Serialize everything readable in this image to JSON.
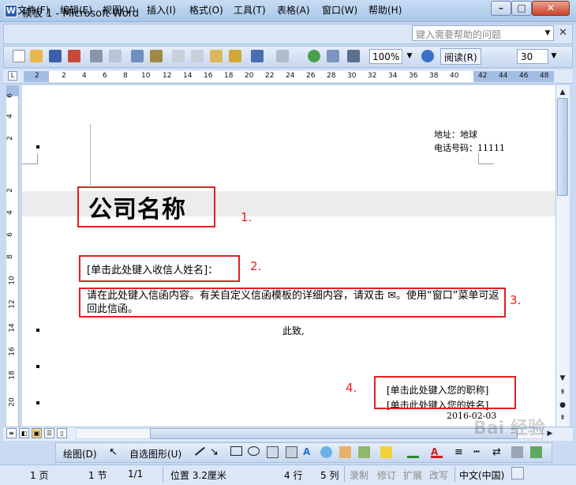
{
  "window": {
    "title": "模板 1 - Microsoft Word"
  },
  "menu": {
    "items": [
      "文件(F)",
      "编辑(E)",
      "视图(V)",
      "插入(I)",
      "格式(O)",
      "工具(T)",
      "表格(A)",
      "窗口(W)",
      "帮助(H)"
    ],
    "help_placeholder": "键入需要帮助的问题"
  },
  "toolbar": {
    "zoom": "100%",
    "read_label": "阅读(R)",
    "font_size": "30"
  },
  "ruler": {
    "h_numbers": [
      "2",
      "2",
      "4",
      "6",
      "8",
      "10",
      "12",
      "14",
      "16",
      "18",
      "20",
      "22",
      "24",
      "26",
      "28",
      "30",
      "32",
      "34",
      "36",
      "38",
      "40",
      "42",
      "44",
      "46",
      "48"
    ],
    "v_numbers": [
      "6",
      "4",
      "2",
      "2",
      "4",
      "6",
      "8",
      "10",
      "12",
      "14",
      "16",
      "18",
      "20"
    ]
  },
  "document": {
    "address": "地址：地球",
    "phone": "电话号码：11111",
    "company_name": "公司名称",
    "recipient": "[单击此处键入收信人姓名]：",
    "body": "请在此处键入信函内容。有关自定义信函模板的详细内容，请双击 ✉。使用“窗口”菜单可返回此信函。",
    "closing": "此致,",
    "sender_title": "[单击此处键入您的职称]",
    "sender_name": "[单击此处键入您的姓名]",
    "date": "2016-02-03"
  },
  "annotations": [
    "1.",
    "2.",
    "3.",
    "4."
  ],
  "drawing": {
    "draw_label": "绘图(D)",
    "autoshape_label": "自选图形(U)"
  },
  "status": {
    "page": "1 页",
    "section": "1 节",
    "page_of": "1/1",
    "position": "位置 3.2厘米",
    "line": "4 行",
    "column": "5 列",
    "rec": "录制",
    "trk": "修订",
    "ext": "扩展",
    "ovr": "改写",
    "language": "中文(中国)"
  },
  "watermark": "Bai 经验"
}
